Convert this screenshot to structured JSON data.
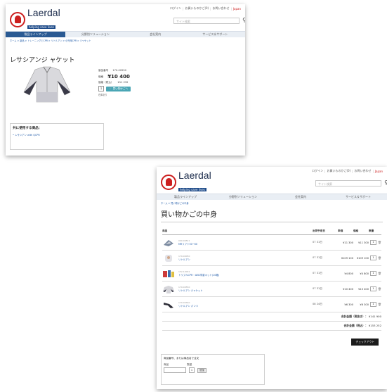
{
  "header": {
    "brand": "Laerdal",
    "tagline": "helping save lives",
    "links": [
      "ログイン",
      "お買いものかご(0)",
      "お問い合わせ",
      "Japan"
    ],
    "search_placeholder": "サイト検索"
  },
  "nav": [
    "製品ラインアップ",
    "分野別ソリューション",
    "会社案内",
    "サービス＆サポート"
  ],
  "product_page": {
    "breadcrumb": "ホーム > 製品 > トレーニングとCPR > リトルアン > 小児用CPR > ジャケット",
    "title": "レサシアンジ ャケット",
    "product_no_label": "製品番号",
    "product_no": "170-00550",
    "price_label": "価格",
    "price": "¥10 400",
    "tax_label": "価格（税込）",
    "tax_price": "¥11 232",
    "qty": "1",
    "add_button": "買い物かごへ",
    "stock": "在庫あり",
    "related_title": "共に使用する商品：",
    "related_item": "レサシアン with QCPR"
  },
  "cart_page": {
    "breadcrumb": "ホーム > 買い物かごの中身",
    "title": "買い物かごの中身",
    "columns": [
      "商品",
      "出荷予定日",
      "単価",
      "価格",
      "数量"
    ],
    "rows": [
      {
        "code": "090-00541",
        "name": "MRリフト50~60",
        "ship": "07 31日",
        "unit": "¥11 300",
        "total": "¥11 300",
        "qty": "1"
      },
      {
        "code": "170-00050",
        "name": "リトルアン",
        "ship": "07 31日",
        "unit": "¥109 100",
        "total": "¥109 100",
        "qty": "1"
      },
      {
        "code": "152-10001",
        "name": "トリプルCPR・AED学習キット(10箱)",
        "ship": "07 31日",
        "unit": "¥4 800",
        "total": "¥4 800",
        "qty": "1"
      },
      {
        "code": "170-00550",
        "name": "リトルアン ジャケット",
        "ship": "07 31日",
        "unit": "¥10 400",
        "total": "¥10 400",
        "qty": "1"
      },
      {
        "code": "170-00340",
        "name": "リトルアン パンツ",
        "ship": "08 24日",
        "unit": "¥6 300",
        "total": "¥6 300",
        "qty": "1"
      }
    ],
    "subtotal_label": "合計金額（税抜き）：",
    "subtotal": "¥141 900",
    "total_label": "合計金額（税込）：",
    "total": "¥153 252",
    "checkout": "チェックアウト",
    "quick_title": "商品番号、または商品名で注文",
    "quick_labels": [
      "商品",
      "数量"
    ],
    "quick_qty": "1",
    "quick_button": "追加"
  }
}
